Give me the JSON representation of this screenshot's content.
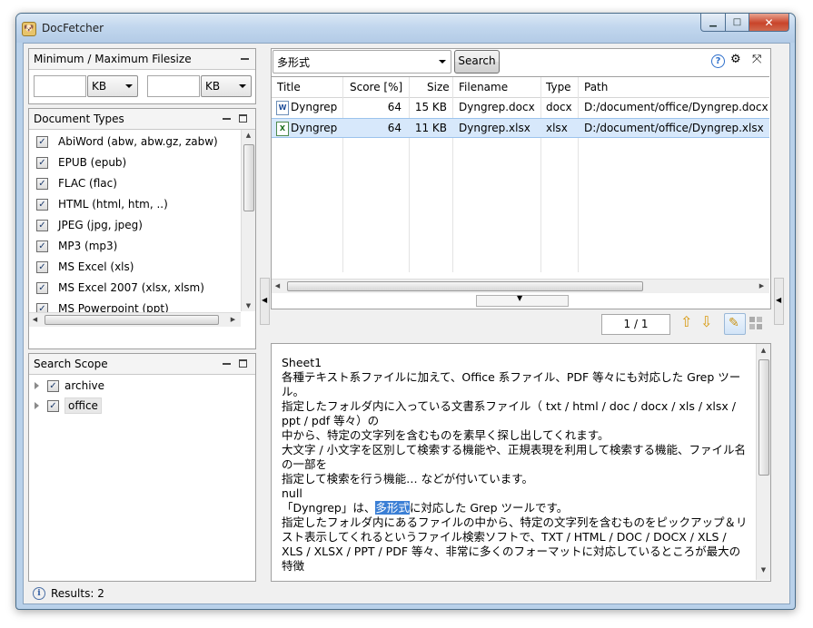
{
  "window": {
    "title": "DocFetcher",
    "minimize": "▁",
    "maximize": "□",
    "close": "✕"
  },
  "filesize": {
    "title": "Minimum / Maximum Filesize",
    "min_value": "",
    "max_value": "",
    "min_unit": "KB",
    "max_unit": "KB"
  },
  "doctypes": {
    "title": "Document Types",
    "items": [
      {
        "label": "AbiWord (abw, abw.gz, zabw)",
        "checked": true
      },
      {
        "label": "EPUB (epub)",
        "checked": true
      },
      {
        "label": "FLAC (flac)",
        "checked": true
      },
      {
        "label": "HTML (html, htm, ..)",
        "checked": true
      },
      {
        "label": "JPEG (jpg, jpeg)",
        "checked": true
      },
      {
        "label": "MP3 (mp3)",
        "checked": true
      },
      {
        "label": "MS Excel (xls)",
        "checked": true
      },
      {
        "label": "MS Excel 2007 (xlsx, xlsm)",
        "checked": true
      },
      {
        "label": "MS Powerpoint (ppt)",
        "checked": true
      }
    ]
  },
  "scope": {
    "title": "Search Scope",
    "items": [
      {
        "label": "archive",
        "checked": true
      },
      {
        "label": "office",
        "checked": true
      }
    ]
  },
  "search": {
    "query": "多形式",
    "button": "Search"
  },
  "results": {
    "columns": [
      "Title",
      "Score [%]",
      "Size",
      "Filename",
      "Type",
      "Path"
    ],
    "rows": [
      {
        "icon": "W",
        "title": "Dyngrep",
        "score": "64",
        "size": "15 KB",
        "filename": "Dyngrep.docx",
        "type": "docx",
        "path": "D:/document/office/Dyngrep.docx"
      },
      {
        "icon": "X",
        "title": "Dyngrep",
        "score": "64",
        "size": "11 KB",
        "filename": "Dyngrep.xlsx",
        "type": "xlsx",
        "path": "D:/document/office/Dyngrep.xlsx"
      }
    ]
  },
  "preview": {
    "page": "1 / 1",
    "lines_before": "Sheet1\n各種テキスト系ファイルに加えて、Office 系ファイル、PDF 等々にも対応した Grep ツール。\n指定したフォルダ内に入っている文書系ファイル（ txt / html / doc / docx / xls / xlsx / ppt / pdf 等々）の\n中から、特定の文字列を含むものを素早く探し出してくれます。\n大文字 / 小文字を区別して検索する機能や、正規表現を利用して検索する機能、ファイル名の一部を\n指定して検索を行う機能… などが付いています。\nnull\n「Dyngrep」は、",
    "highlight": "多形式",
    "lines_after": "に対応した Grep ツールです。\n指定したフォルダ内にあるファイルの中から、特定の文字列を含むものをピックアップ＆リスト表示してくれるというファイル検索ソフトで、TXT / HTML / DOC / DOCX / XLS / XLS / XLSX / PPT / PDF 等々、非常に多くのフォーマットに対応しているところが最大の特徴"
  },
  "status": {
    "text": "Results: 2"
  },
  "icons": {
    "help": "?",
    "prefs": "⚙",
    "compact": "⤧",
    "up": "⇧",
    "down": "⇩"
  }
}
